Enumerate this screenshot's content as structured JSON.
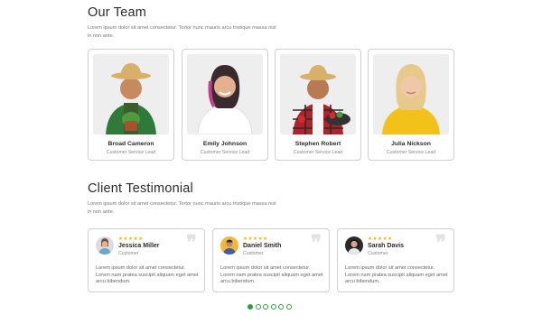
{
  "team_section": {
    "title": "Our Team",
    "description": "Lorem ipsum dolor sit amet consectetur. Tortor nunc mauris arcu tristique massa nisl in non ante.",
    "members": [
      {
        "name": "Broad Cameron",
        "role": "Customer Service Lead",
        "photo_bg": "#eeeeee",
        "shirt": "#2f7a3b"
      },
      {
        "name": "Emily Johnson",
        "role": "Customer Service Lead",
        "photo_bg": "#eeeeee",
        "shirt": "#ffffff"
      },
      {
        "name": "Stephen Robert",
        "role": "Customer Service Lead",
        "photo_bg": "#eeeeee",
        "shirt": "#b0232a"
      },
      {
        "name": "Julia Nickson",
        "role": "Customer Service Lead",
        "photo_bg": "#eeeeee",
        "shirt": "#f2c21b"
      }
    ]
  },
  "testimonial_section": {
    "title": "Client Testimonial",
    "description": "Lorem ipsum dolor sit amet consectetur. Tortor nunc mauris arcu tristique massa nisl in non ante.",
    "items": [
      {
        "name": "Jessica Miller",
        "role": "Customer",
        "stars": "★★★★★",
        "quote": "Lorem ipsum dolor sit amet consectetur. Lorem nam pratea suscipit aliquam eget amet arcu bibendum.",
        "avatar_bg": "#dcdcdc"
      },
      {
        "name": "Daniel Smith",
        "role": "Customer",
        "stars": "★★★★★",
        "quote": "Lorem ipsum dolor sit amet consectetur. Lorem nam pratea suscipit aliquam eget amet arcu bibendum.",
        "avatar_bg": "#f4b63c"
      },
      {
        "name": "Sarah Davis",
        "role": "Customer",
        "stars": "★★★★★",
        "quote": "Lorem ipsum dolor sit amet consectetur. Lorem nam pratea suscipit aliquam eget amet arcu bibendum.",
        "avatar_bg": "#2b2b2b"
      }
    ],
    "quote_glyph": "❞"
  },
  "carousel": {
    "total_pages": 6,
    "active_page": 1
  },
  "colors": {
    "accent": "#2e9e3a",
    "star": "#f5b400",
    "card_border": "#cfcfcf"
  }
}
